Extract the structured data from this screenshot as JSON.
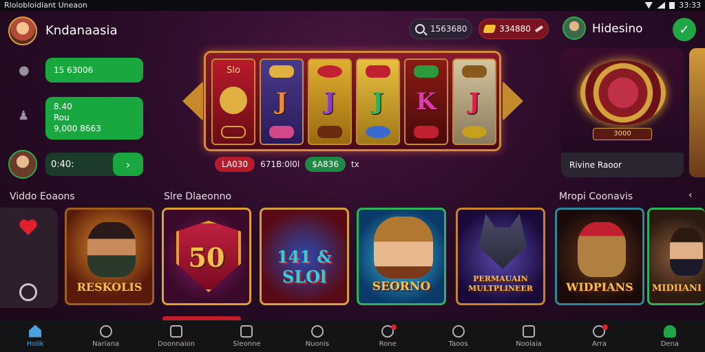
{
  "status_bar": {
    "left_text": "Rlolobloidiant Uneaon",
    "time": "33:33"
  },
  "header": {
    "user_name": "Kndanaasia",
    "search_value": "1563680",
    "coins_value": "334880",
    "brand_name": "Hidesino"
  },
  "left_panel": {
    "button_1": "15 63006",
    "button_2_line1": "8.40",
    "button_2_line2": "Rou",
    "button_2_line3": "9,000 8663",
    "balance_value": "0:40:"
  },
  "slot_machine": {
    "reels": [
      "J",
      "J",
      "J",
      "K",
      "J"
    ],
    "stat_red": "LA030",
    "stat_text": "671B:0l0l",
    "stat_green": "$A836",
    "stat_suffix": "tx"
  },
  "featured": {
    "badge": "3000",
    "footer_label": "Rivine Raoor"
  },
  "sections": {
    "left_title": "Viddo Eoaons",
    "middle_title": "Slre Dlaeonno",
    "right_title": "Mropi Coonavis"
  },
  "games": [
    {
      "title": "RESKOLIS",
      "accent": "#d87a2a"
    },
    {
      "title": "50",
      "accent": "#e0a030"
    },
    {
      "title": "141 & SLOl",
      "accent": "#d4a23a"
    },
    {
      "title": "SEORNO",
      "accent": "#2fb35a"
    },
    {
      "title": "PERMAUAIN MULTPLINEER",
      "accent": "#c8842a"
    },
    {
      "title": "WIDPIANS",
      "accent": "#2a8a9a"
    },
    {
      "title": "MIDIIANI",
      "accent": "#2fb35a"
    }
  ],
  "bottom_nav": [
    {
      "label": "Holik",
      "icon": "home-icon"
    },
    {
      "label": "Nariana",
      "icon": "location-icon"
    },
    {
      "label": "Doonnaion",
      "icon": "image-icon"
    },
    {
      "label": "Sleonne",
      "icon": "calendar-icon"
    },
    {
      "label": "Nuonis",
      "icon": "info-icon"
    },
    {
      "label": "Rone",
      "icon": "heart-icon"
    },
    {
      "label": "Taoos",
      "icon": "search-icon"
    },
    {
      "label": "Noolaia",
      "icon": "car-icon"
    },
    {
      "label": "Arra",
      "icon": "bell-icon"
    },
    {
      "label": "Dena",
      "icon": "user-icon"
    }
  ]
}
